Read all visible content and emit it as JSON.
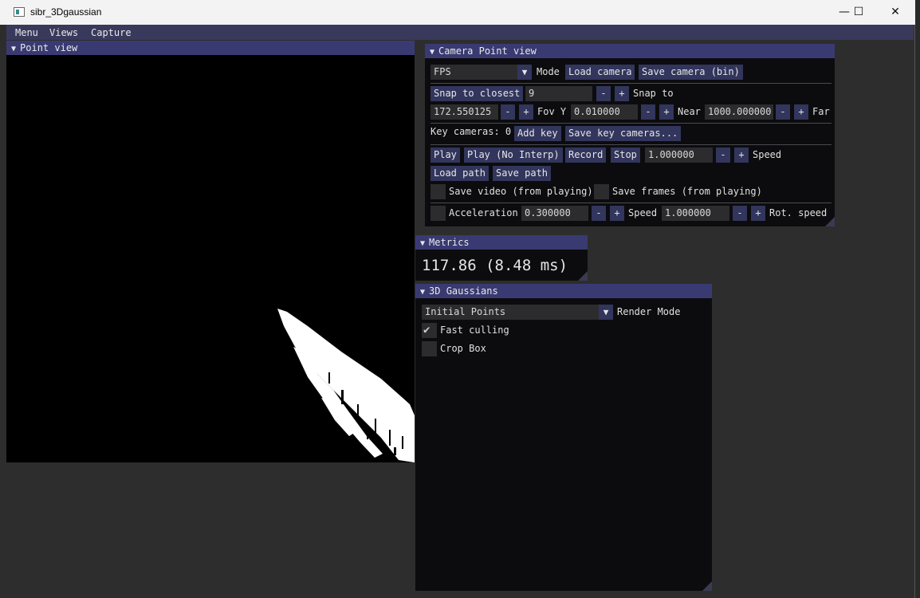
{
  "window": {
    "title": "sibr_3Dgaussian",
    "controls": {
      "minimize": "—",
      "maximize": "☐",
      "close": "✕"
    }
  },
  "menubar": {
    "items": [
      "Menu",
      "Views",
      "Capture"
    ]
  },
  "point_view": {
    "title": "Point view",
    "collapse_glyph": "▼"
  },
  "camera_panel": {
    "title": "Camera Point view",
    "collapse_glyph": "▼",
    "mode_value": "FPS",
    "mode_label": "Mode",
    "load_camera": "Load camera",
    "save_camera": "Save camera (bin)",
    "snap_button": "Snap to closest",
    "snap_value": "9",
    "snap_label": "Snap to",
    "fov_value": "172.550125",
    "fov_label": "Fov Y",
    "near_value": "0.010000",
    "near_label": "Near",
    "far_value": "1000.000000",
    "far_label": "Far",
    "key_cameras_label": "Key cameras: 0",
    "add_key": "Add key",
    "save_key_cameras": "Save key cameras...",
    "play": "Play",
    "play_no_interp": "Play (No Interp)",
    "record": "Record",
    "stop": "Stop",
    "speed_value": "1.000000",
    "speed_label": "Speed",
    "load_path": "Load path",
    "save_path": "Save path",
    "save_video_label": "Save video (from playing)",
    "save_frames_label": "Save frames (from playing)",
    "acceleration_label": "Acceleration",
    "acceleration_value": "0.300000",
    "move_speed_label": "Speed",
    "move_speed_value": "1.000000",
    "rot_speed_label": "Rot. speed",
    "minus": "-",
    "plus": "+"
  },
  "metrics": {
    "title": "Metrics",
    "collapse_glyph": "▼",
    "fps_text": "117.86 (8.48 ms)"
  },
  "gaussians": {
    "title": "3D Gaussians",
    "collapse_glyph": "▼",
    "render_mode_value": "Initial Points",
    "render_mode_label": "Render Mode",
    "fast_culling_label": "Fast culling",
    "fast_culling_checked": true,
    "crop_box_label": "Crop Box",
    "crop_box_checked": false
  },
  "colors": {
    "title_bar": "#3a3a72",
    "button": "#32355c",
    "panel_bg": "#0c0c0e",
    "point_cloud": "#ffffff"
  },
  "icons": {
    "combo_arrow": "▼",
    "check_mark": "✔"
  }
}
